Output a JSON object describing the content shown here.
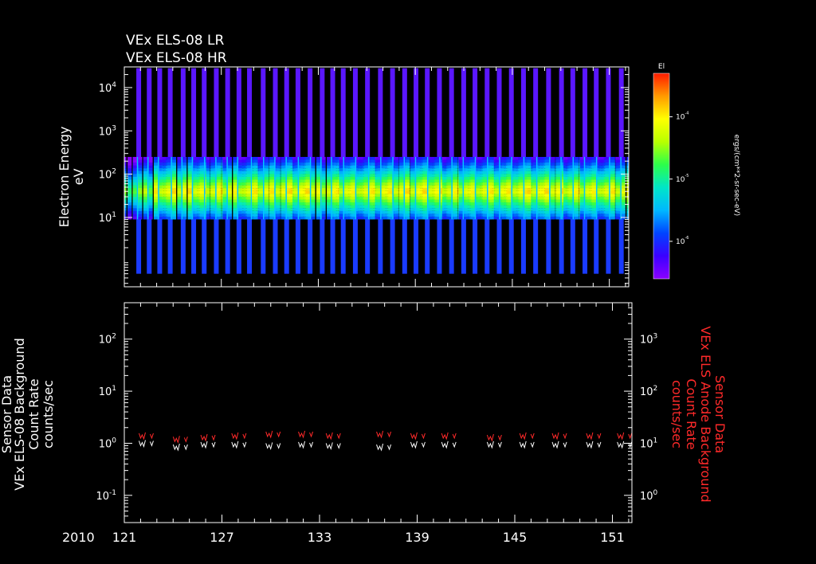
{
  "colors": {
    "background": "#000000",
    "axes": "#ffffff",
    "right_axis_label": "#ff2a2a",
    "colorbar_stops": [
      "#8a00ff",
      "#3b00ff",
      "#0044ff",
      "#00b8ff",
      "#00e6c8",
      "#2cff4a",
      "#b8ff00",
      "#ffff00",
      "#ff9a00",
      "#ff1a00"
    ]
  },
  "title_lines": [
    "VEx ELS-08 LR",
    "VEx ELS-08 HR"
  ],
  "year_label": "2010",
  "chart_data": [
    {
      "type": "heatmap",
      "ylabel": [
        "Electron Energy",
        "eV"
      ],
      "yscale": "log",
      "ylim": [
        0.25,
        30000
      ],
      "yticks": [
        {
          "value": 10,
          "label": "10",
          "exp": "1"
        },
        {
          "value": 100,
          "label": "10",
          "exp": "2"
        },
        {
          "value": 1000,
          "label": "10",
          "exp": "3"
        },
        {
          "value": 10000,
          "label": "10",
          "exp": "4"
        }
      ],
      "xlim": [
        121,
        152.2
      ],
      "xticks": [
        121,
        127,
        133,
        139,
        145,
        151
      ],
      "passes_x": [
        121.25,
        121.9,
        122.55,
        123.2,
        124.0,
        124.65,
        125.3,
        126.05,
        126.75,
        127.45,
        128.1,
        128.95,
        129.7,
        130.4,
        131.1,
        131.85,
        132.6,
        133.25,
        133.9,
        134.65,
        135.4,
        136.2,
        136.95,
        137.7,
        138.4,
        139.1,
        139.85,
        140.6,
        141.35,
        142.05,
        142.8,
        143.55,
        144.3,
        145.05,
        145.8,
        146.6,
        147.4,
        148.1,
        148.85,
        149.55,
        150.3,
        151.1,
        151.8
      ],
      "energy_band": [
        9,
        250
      ],
      "colorbar": {
        "title": "El",
        "label": "ergs/(cm**2-sr-sec-eV)",
        "ticks": [
          {
            "value": 1e-06,
            "label": "10",
            "exp": "-6"
          },
          {
            "value": 1e-05,
            "label": "10",
            "exp": "-5"
          },
          {
            "value": 0.0001,
            "label": "10",
            "exp": "-4"
          }
        ],
        "range": [
          2.5e-07,
          0.0005
        ]
      }
    },
    {
      "type": "scatter",
      "ylabel": [
        "VEx ELS-08 Background",
        "Count Rate",
        "counts/sec"
      ],
      "ylabel_partial": "Sensor Data",
      "yscale": "log",
      "ylim": [
        0.03,
        500
      ],
      "yticks": [
        {
          "value": 0.1,
          "label": "10",
          "exp": "-1"
        },
        {
          "value": 1,
          "label": "10",
          "exp": "0"
        },
        {
          "value": 10,
          "label": "10",
          "exp": "1"
        },
        {
          "value": 100,
          "label": "10",
          "exp": "2"
        }
      ],
      "y2label": [
        "Sensor Data",
        "VEx ELS Anode Background",
        "Count Rate",
        "counts/sec"
      ],
      "y2scale": "log",
      "y2lim": [
        0.3,
        5000
      ],
      "y2ticks": [
        {
          "value": 1,
          "label": "10",
          "exp": "0"
        },
        {
          "value": 10,
          "label": "10",
          "exp": "1"
        },
        {
          "value": 100,
          "label": "10",
          "exp": "2"
        },
        {
          "value": 1000,
          "label": "10",
          "exp": "3"
        }
      ],
      "xlim": [
        121,
        152.2
      ],
      "xticks": [
        121,
        127,
        133,
        139,
        145,
        151
      ],
      "series": [
        {
          "color": "#ffffff",
          "x": [
            122.1,
            124.2,
            125.9,
            127.8,
            129.9,
            131.9,
            133.6,
            136.7,
            138.8,
            140.7,
            143.5,
            145.5,
            147.5,
            149.6,
            151.5
          ],
          "y": [
            1.0,
            0.85,
            0.95,
            0.95,
            0.9,
            0.95,
            0.9,
            0.85,
            0.95,
            0.95,
            0.95,
            0.95,
            0.95,
            0.95,
            0.95
          ]
        },
        {
          "color": "#ff2a2a",
          "x": [
            122.1,
            124.2,
            125.9,
            127.8,
            129.9,
            131.9,
            133.6,
            136.7,
            138.8,
            140.7,
            143.5,
            145.5,
            147.5,
            149.6,
            151.5
          ],
          "y": [
            14,
            12,
            13,
            14,
            15,
            15,
            14,
            15,
            14,
            14,
            13,
            14,
            14,
            14,
            14
          ]
        }
      ]
    }
  ]
}
